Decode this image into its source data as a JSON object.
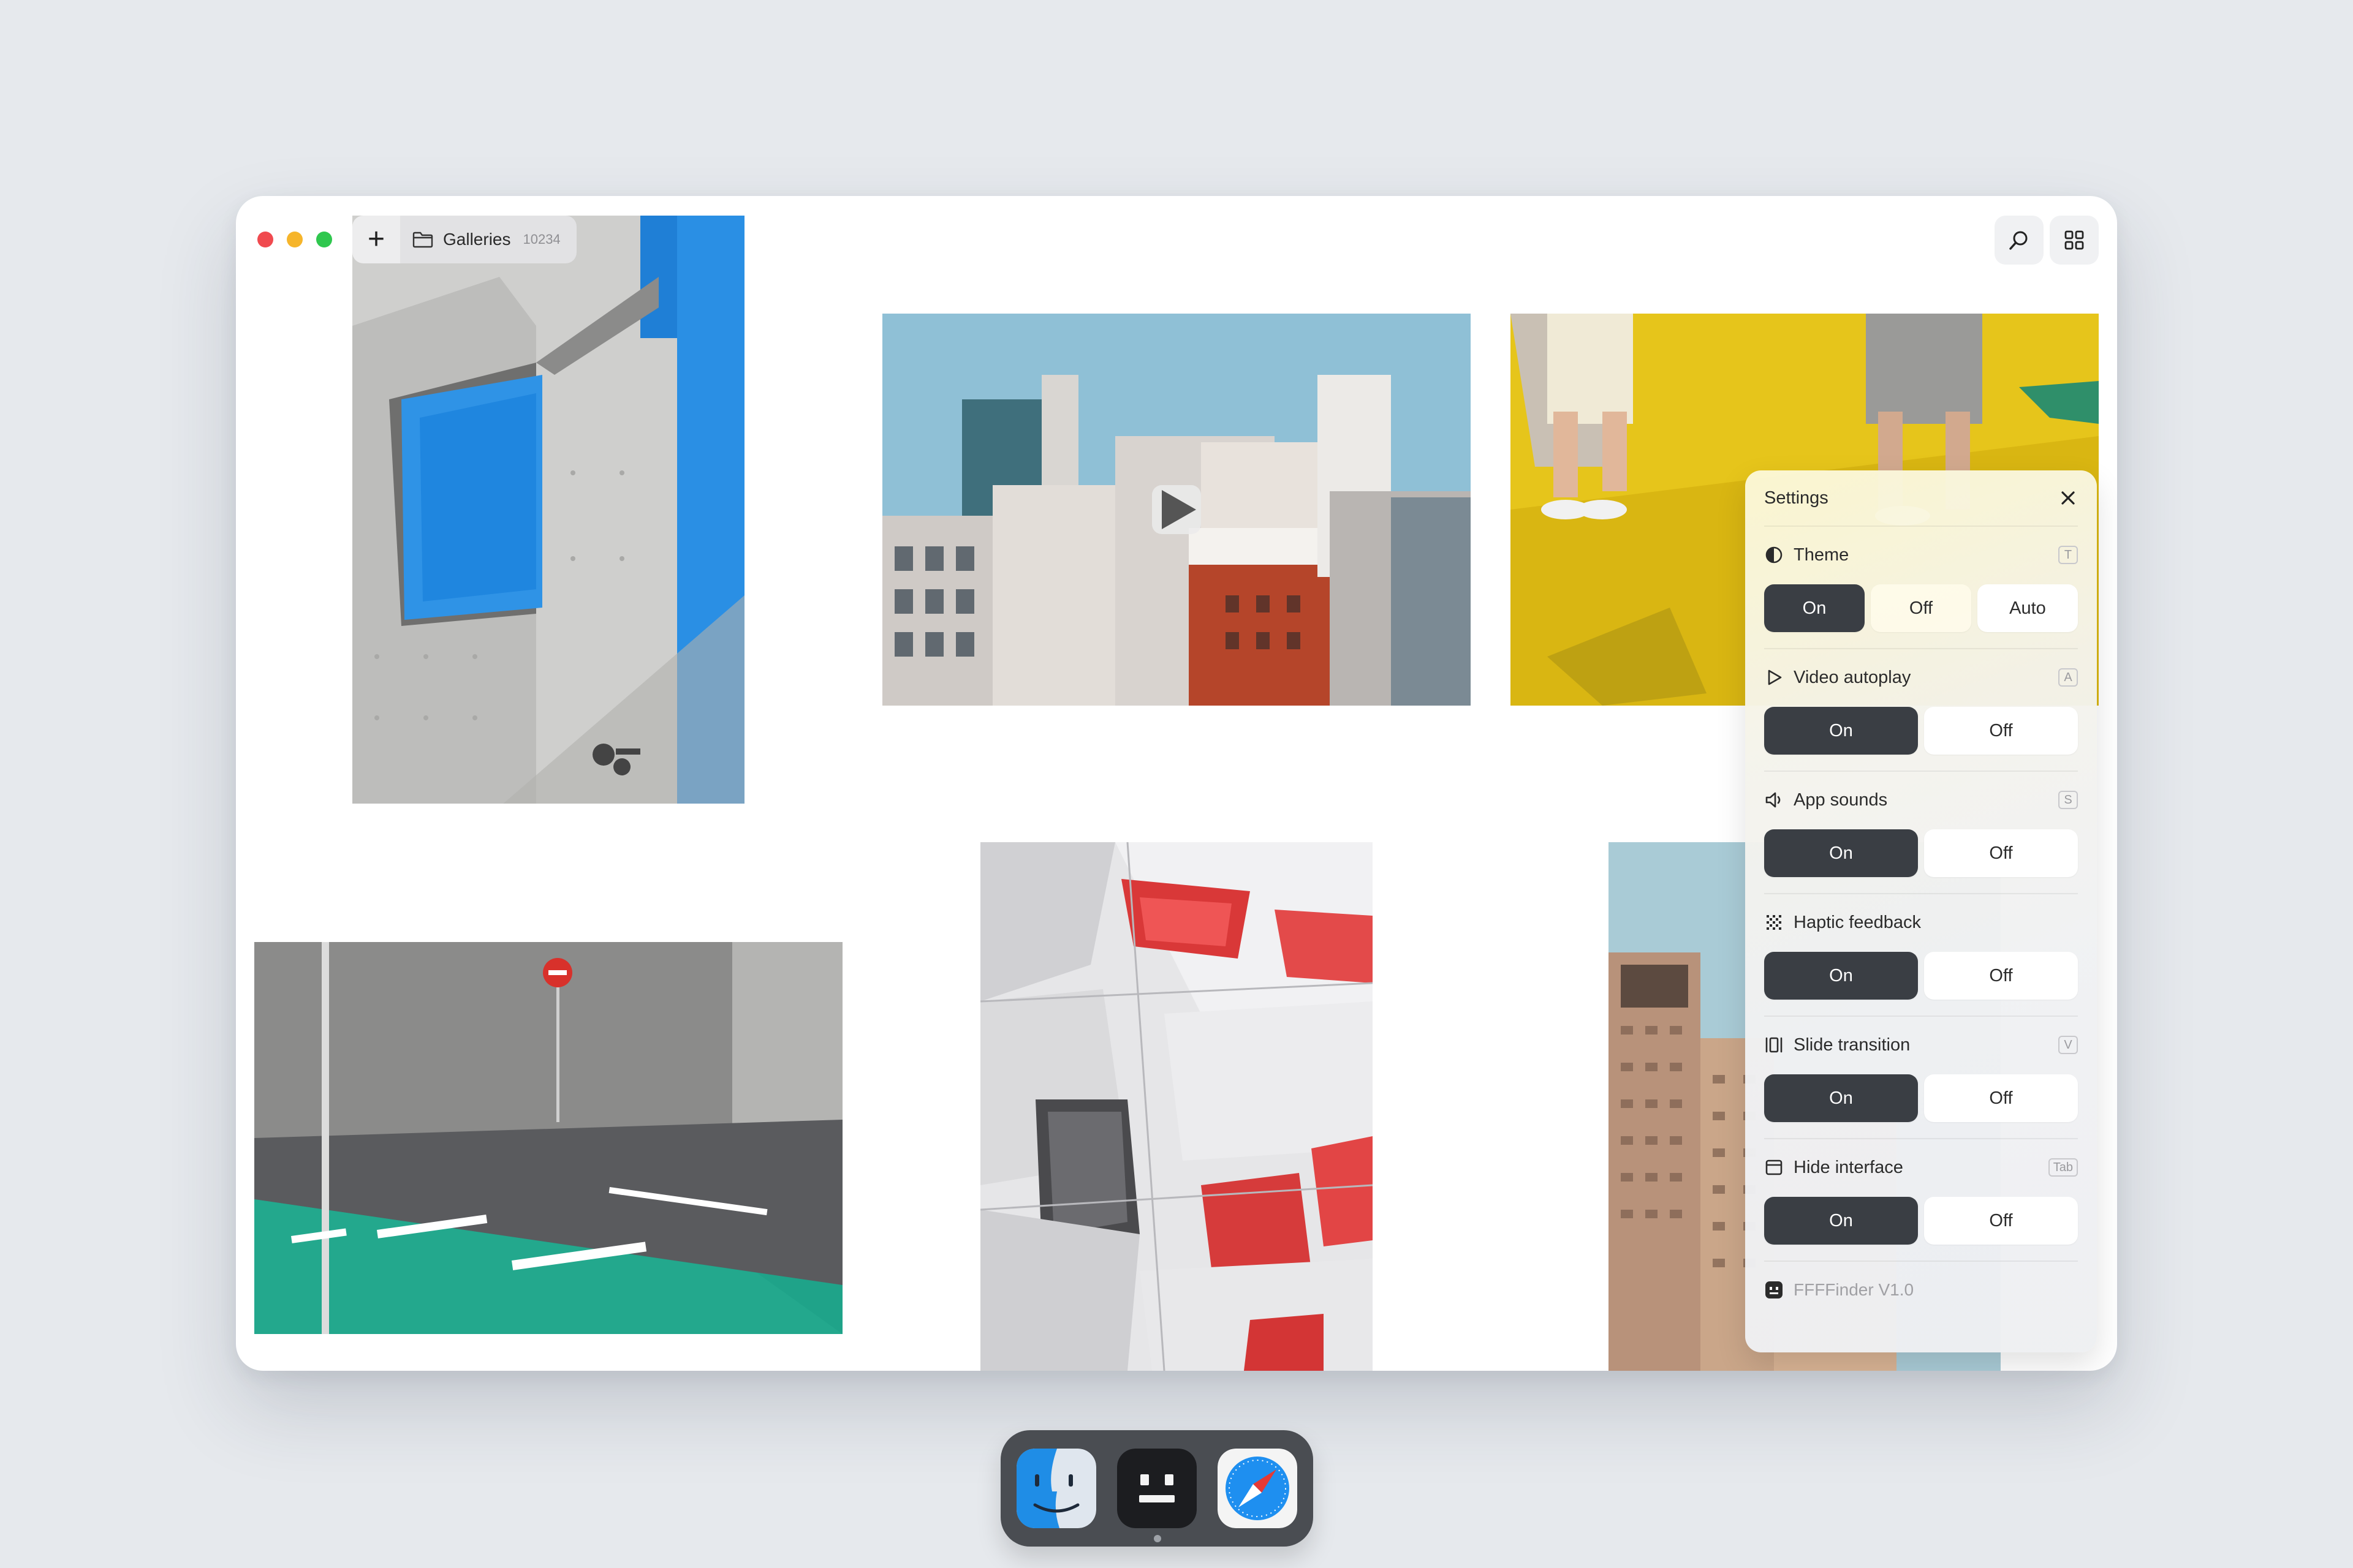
{
  "window": {
    "new_button": "+",
    "gallery": {
      "label": "Galleries",
      "count": "10234"
    }
  },
  "tiles": [
    {
      "name": "concrete-building-photo",
      "icon": "photo"
    },
    {
      "name": "tokyo-street-video",
      "icon": "play-icon"
    },
    {
      "name": "yellow-ground-photo",
      "icon": "photo"
    },
    {
      "name": "road-markings-photo",
      "icon": "photo"
    },
    {
      "name": "robot-statue-photo",
      "icon": "photo"
    },
    {
      "name": "tower-photo",
      "icon": "photo"
    }
  ],
  "settings": {
    "title": "Settings",
    "items": [
      {
        "label": "Theme",
        "shortcut": "T",
        "options": [
          "On",
          "Off",
          "Auto"
        ],
        "selected": "On"
      },
      {
        "label": "Video autoplay",
        "shortcut": "A",
        "options": [
          "On",
          "Off"
        ],
        "selected": "On"
      },
      {
        "label": "App sounds",
        "shortcut": "S",
        "options": [
          "On",
          "Off"
        ],
        "selected": "On"
      },
      {
        "label": "Haptic feedback",
        "shortcut": "",
        "options": [
          "On",
          "Off"
        ],
        "selected": "On"
      },
      {
        "label": "Slide transition",
        "shortcut": "V",
        "options": [
          "On",
          "Off"
        ],
        "selected": "On"
      },
      {
        "label": "Hide interface",
        "shortcut": "Tab",
        "options": [
          "On",
          "Off"
        ],
        "selected": "On"
      }
    ],
    "footer": "FFFFinder V1.0"
  },
  "dock": [
    "finder-icon",
    "ffffinder-icon",
    "safari-icon"
  ],
  "colors": {
    "accent_dark": "#3a3e44",
    "background": "#e6e9ed"
  }
}
